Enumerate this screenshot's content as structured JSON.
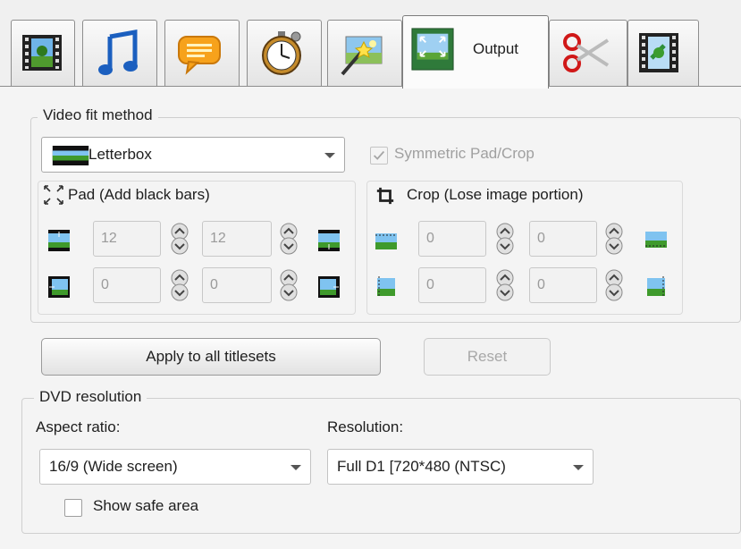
{
  "tabs": [
    {
      "icon": "filmstrip-image-icon"
    },
    {
      "icon": "music-note-icon"
    },
    {
      "icon": "speech-bubble-icon"
    },
    {
      "icon": "stopwatch-icon"
    },
    {
      "icon": "magic-wand-image-icon"
    },
    {
      "icon": "fit-screen-icon",
      "label": "Output"
    },
    {
      "icon": "scissors-icon"
    },
    {
      "icon": "film-link-icon"
    }
  ],
  "video_fit": {
    "group_label": "Video fit method",
    "method": "Letterbox",
    "symmetric_label": "Symmetric Pad/Crop",
    "pad": {
      "label": "Pad (Add black bars)",
      "top": "12",
      "bottom": "12",
      "left": "0",
      "right": "0"
    },
    "crop": {
      "label": "Crop (Lose image portion)",
      "top": "0",
      "bottom": "0",
      "left": "0",
      "right": "0"
    }
  },
  "buttons": {
    "apply": "Apply to all titlesets",
    "reset": "Reset"
  },
  "dvd": {
    "group_label": "DVD resolution",
    "aspect_label": "Aspect ratio:",
    "aspect_value": "16/9 (Wide screen)",
    "resolution_label": "Resolution:",
    "resolution_value": "Full D1 [720*480 (NTSC)",
    "safe_area_label": "Show safe area"
  },
  "colors": {
    "panel_bg": "#f4f4f4",
    "tab_border": "#8d8d8d",
    "disabled_text": "#a0a0a0"
  }
}
